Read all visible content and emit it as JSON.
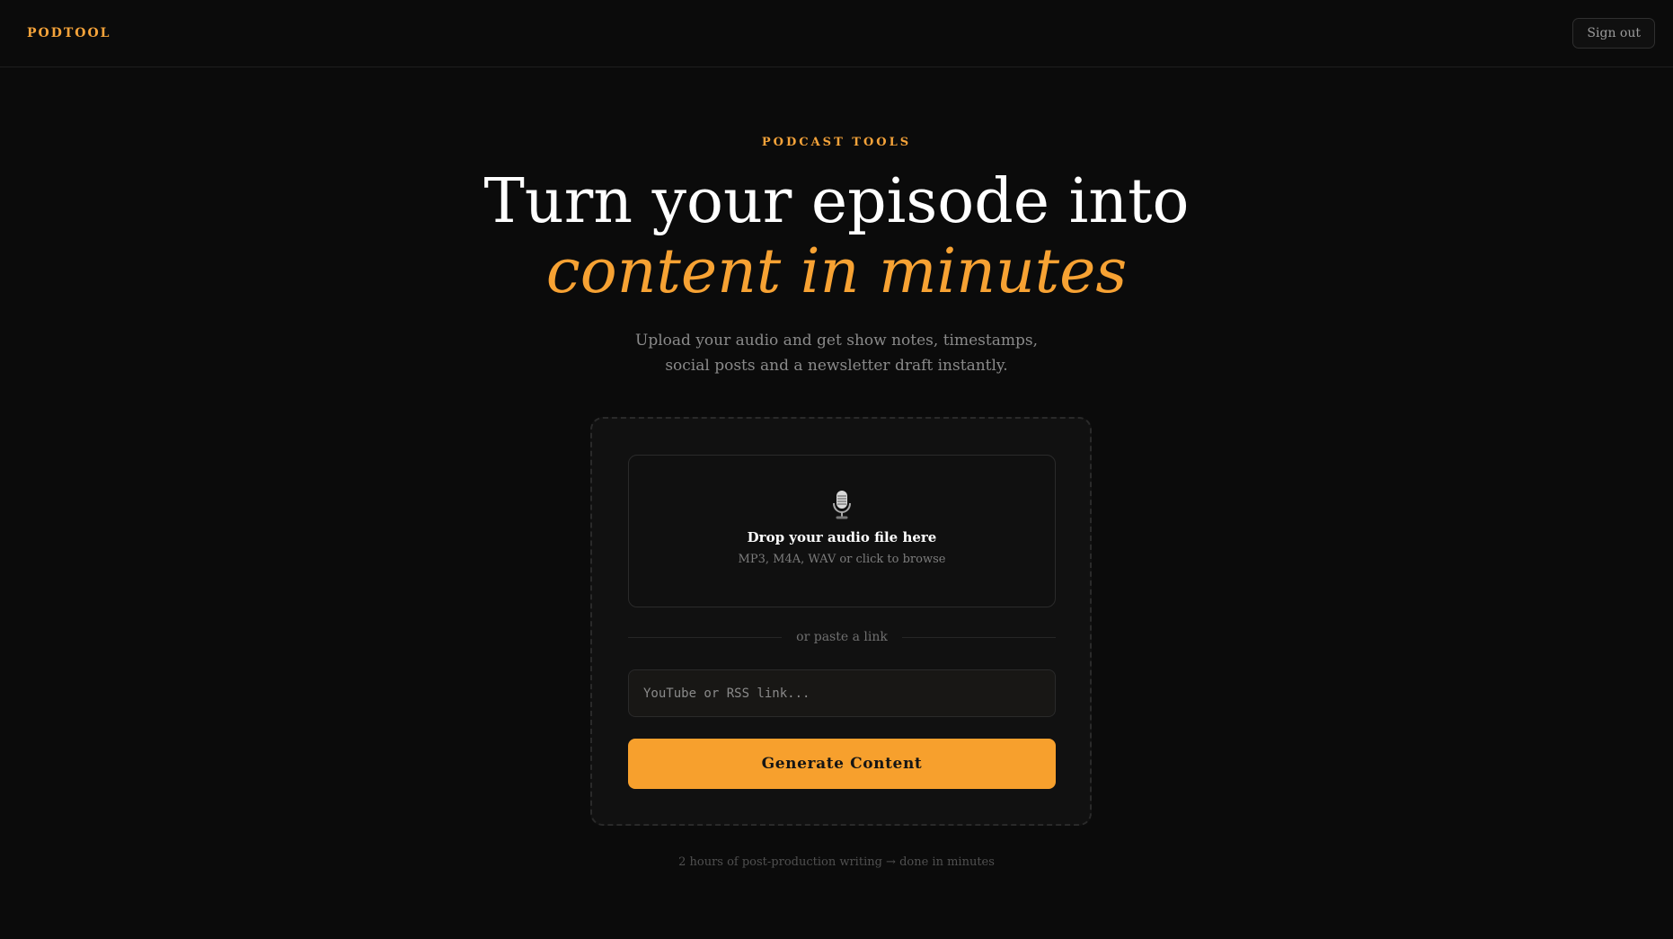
{
  "header": {
    "brand": "PODTOOL",
    "sign_out_label": "Sign out"
  },
  "hero": {
    "eyebrow": "PODCAST TOOLS",
    "headline_line1": "Turn your episode into",
    "headline_line2": "content in minutes",
    "subtitle": "Upload your audio and get show notes, timestamps, social posts and a newsletter draft instantly."
  },
  "upload": {
    "icon": "microphone-icon",
    "title": "Drop your audio file here",
    "subtitle": "MP3, M4A, WAV or click to browse"
  },
  "divider": {
    "label": "or paste a link"
  },
  "link_input": {
    "value": "",
    "placeholder": "YouTube or RSS link..."
  },
  "actions": {
    "generate_label": "Generate Content"
  },
  "footer": {
    "note": "2 hours of post-production writing → done in minutes"
  },
  "colors": {
    "background": "#0b0b0b",
    "accent": "#f7a02d",
    "muted_text": "#8a8a8a"
  }
}
